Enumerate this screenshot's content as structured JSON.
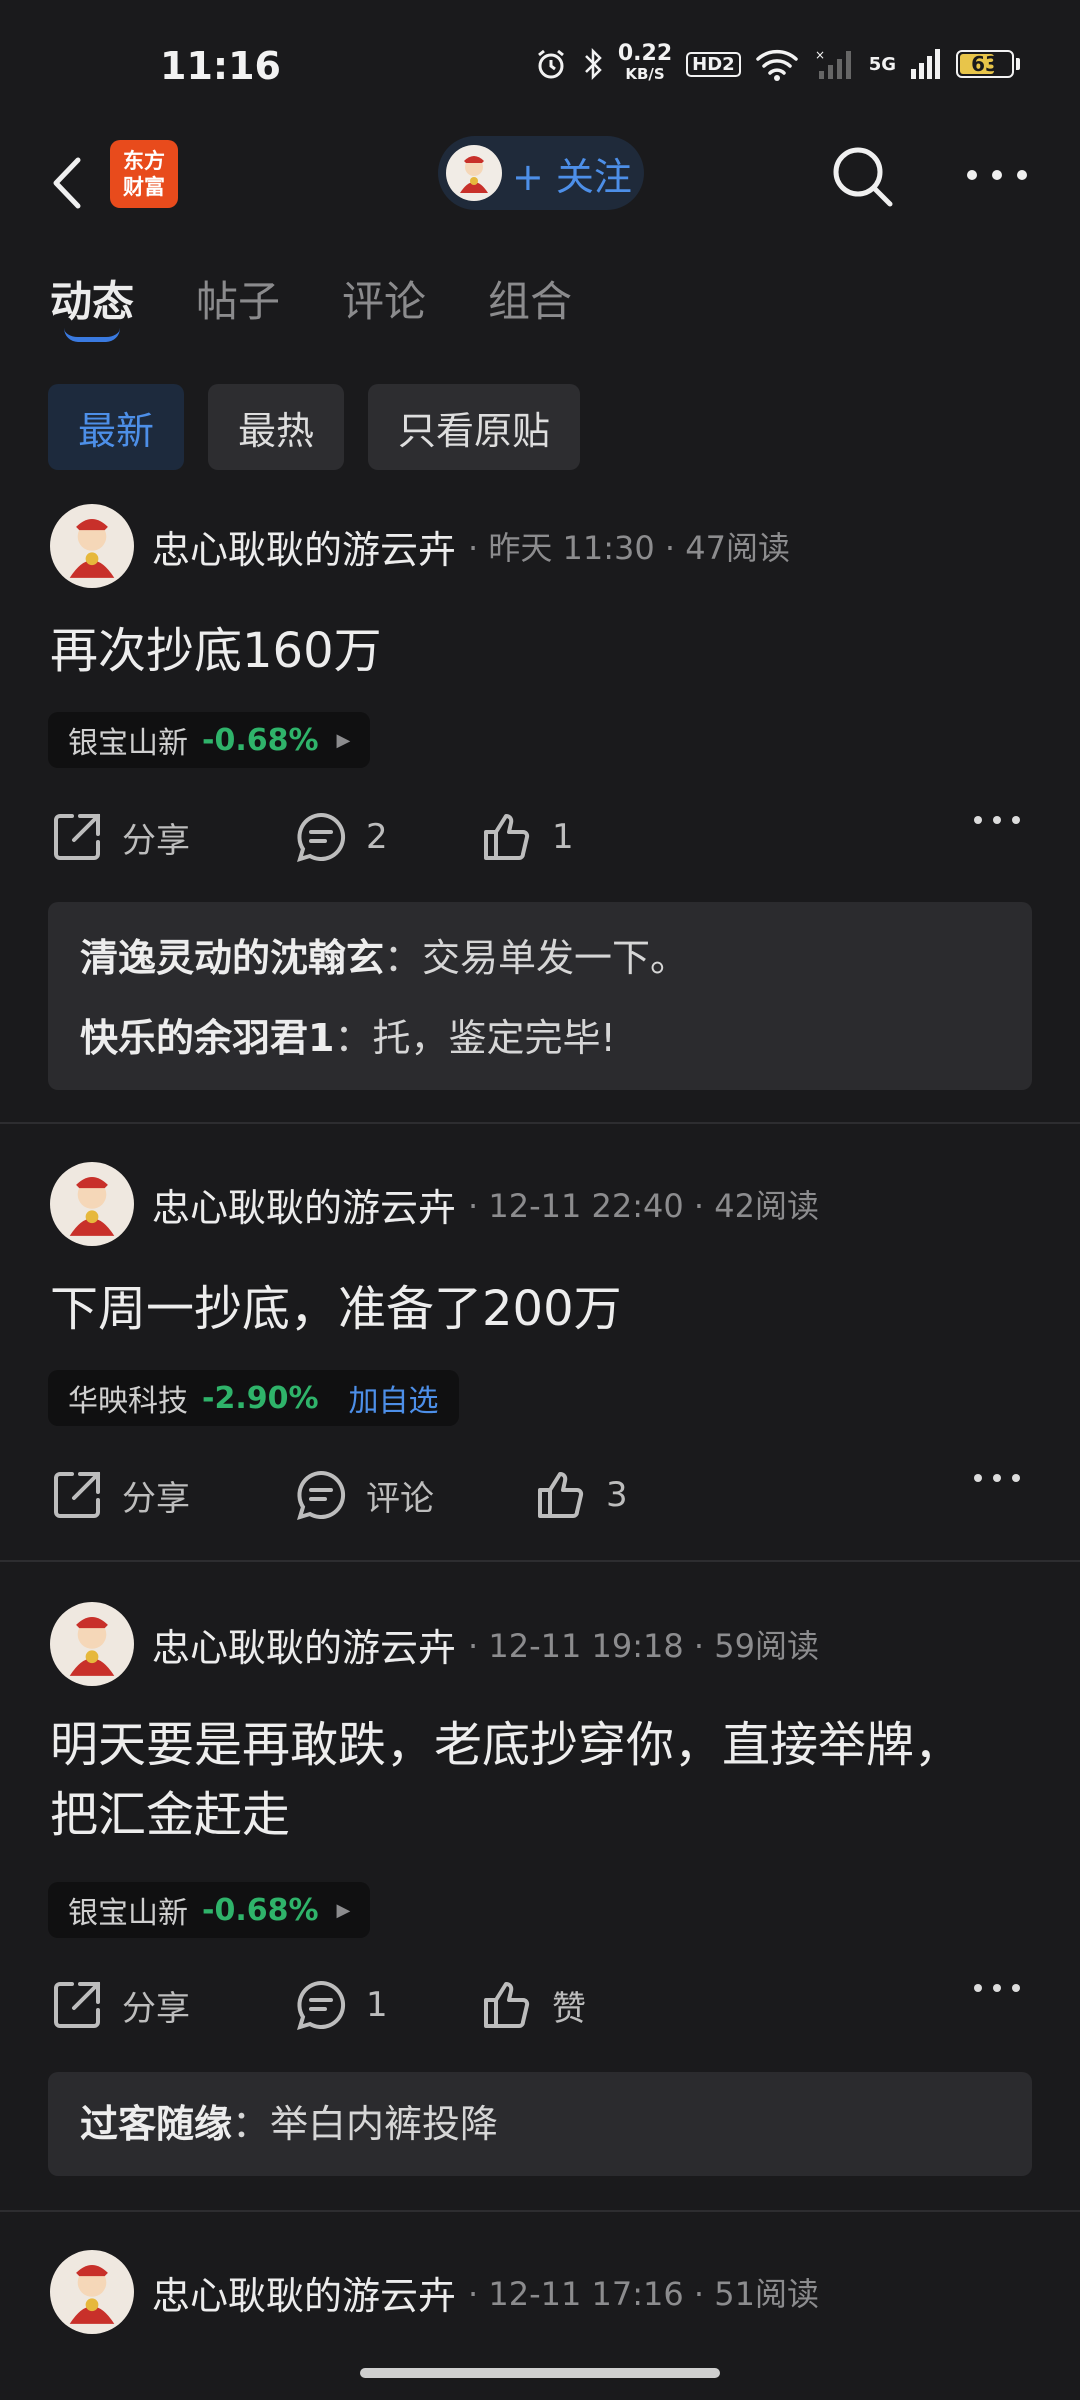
{
  "status_bar": {
    "time": "11:16",
    "net_speed": "0.22",
    "net_unit": "KB/S",
    "hd_label": "HD2",
    "network_5g": "5G",
    "battery": "63"
  },
  "header": {
    "logo_text_line1": "东方",
    "logo_text_line2": "财富",
    "follow_label": "+ 关注"
  },
  "tabs": [
    {
      "label": "动态",
      "active": true
    },
    {
      "label": "帖子",
      "active": false
    },
    {
      "label": "评论",
      "active": false
    },
    {
      "label": "组合",
      "active": false
    }
  ],
  "filters": [
    {
      "label": "最新",
      "active": true
    },
    {
      "label": "最热",
      "active": false
    },
    {
      "label": "只看原贴",
      "active": false
    }
  ],
  "posts": [
    {
      "author": "忠心耿耿的游云卉",
      "meta": "· 昨天 11:30 · 47阅读",
      "content": "再次抄底160万",
      "stock": {
        "name": "银宝山新",
        "change": "-0.68%"
      },
      "share_label": "分享",
      "comment_label": "2",
      "like_label": "1",
      "comments": [
        {
          "user": "清逸灵动的沈翰玄",
          "text": "：交易单发一下。"
        },
        {
          "user": "快乐的余羽君1",
          "text": "：托，鉴定完毕!"
        }
      ]
    },
    {
      "author": "忠心耿耿的游云卉",
      "meta": "· 12-11 22:40 · 42阅读",
      "content": "下周一抄底，准备了200万",
      "stock": {
        "name": "华映科技",
        "change": "-2.90%",
        "add_label": "加自选"
      },
      "share_label": "分享",
      "comment_label": "评论",
      "like_label": "3"
    },
    {
      "author": "忠心耿耿的游云卉",
      "meta": "· 12-11 19:18 · 59阅读",
      "content_line1": "明天要是再敢跌，老底抄穿你，直接举牌，",
      "content_line2": "把汇金赶走",
      "stock": {
        "name": "银宝山新",
        "change": "-0.68%"
      },
      "share_label": "分享",
      "comment_label": "1",
      "like_label": "赞",
      "comments": [
        {
          "user": "过客随缘",
          "text": "：举白内裤投降"
        }
      ]
    },
    {
      "author": "忠心耿耿的游云卉",
      "meta": "· 12-11 17:16 · 51阅读"
    }
  ],
  "colors": {
    "background": "#1a1a1c",
    "accent_blue": "#4d8fe8",
    "down_green": "#2fb36a",
    "logo_orange": "#e84b1c"
  }
}
